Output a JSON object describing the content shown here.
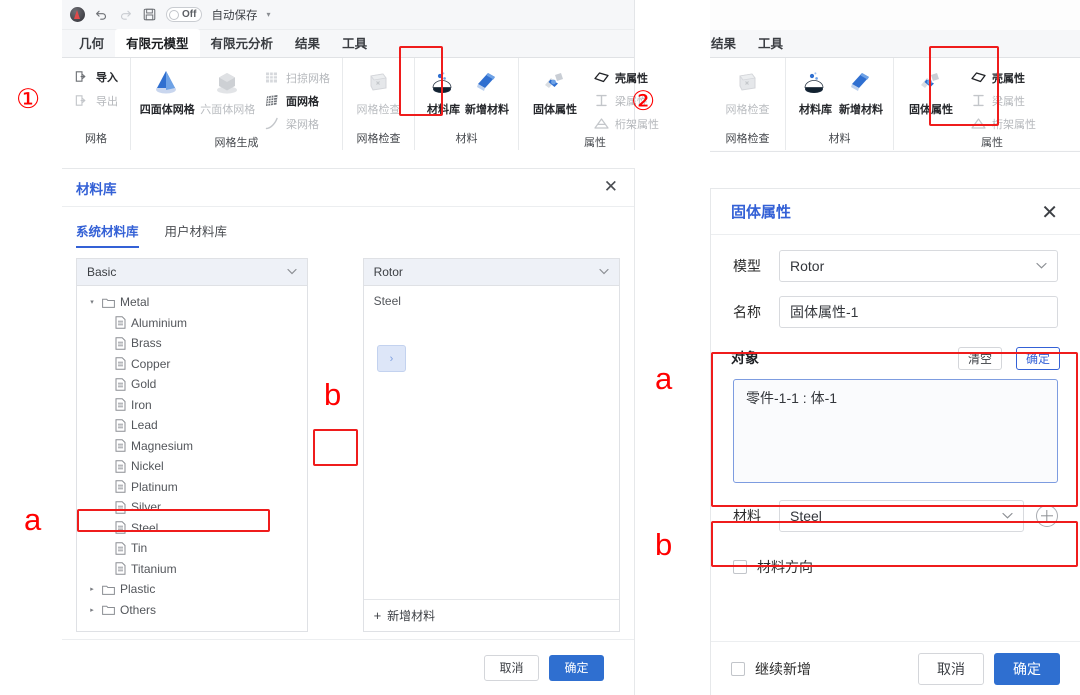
{
  "markers": {
    "step1": "①",
    "step2": "②",
    "lib_a": "a",
    "lib_b": "b",
    "panel_a": "a",
    "panel_b": "b"
  },
  "ribbon": {
    "quick_access": {
      "app_icon": "app-logo-icon",
      "undo_icon": "undo-icon",
      "redo_icon": "redo-icon",
      "save_icon": "save-icon",
      "toggle_label": "Off",
      "autosave_label": "自动保存",
      "caret": "▾"
    },
    "tabs": [
      {
        "label": "几何",
        "active": false
      },
      {
        "label": "有限元模型",
        "active": true
      },
      {
        "label": "有限元分析",
        "active": false
      },
      {
        "label": "结果",
        "active": false
      },
      {
        "label": "工具",
        "active": false
      }
    ],
    "groups": [
      {
        "title": "网格",
        "items": [
          {
            "label": "导入",
            "icon": "import-icon",
            "enabled": true
          },
          {
            "label": "导出",
            "icon": "export-icon",
            "enabled": false
          }
        ]
      },
      {
        "title": "网格生成",
        "items": [
          {
            "label": "四面体网格",
            "icon": "tetra-mesh-icon",
            "enabled": true
          },
          {
            "label": "六面体网格",
            "icon": "hexa-mesh-icon",
            "enabled": false
          },
          {
            "label": "扫掠网格",
            "icon": "sweep-mesh-icon",
            "enabled": false
          },
          {
            "label": "面网格",
            "icon": "face-mesh-icon",
            "enabled": true
          },
          {
            "label": "梁网格",
            "icon": "beam-mesh-icon",
            "enabled": false
          }
        ]
      },
      {
        "title": "网格检查",
        "items": [
          {
            "label": "网格检查",
            "icon": "mesh-check-icon",
            "enabled": false
          }
        ]
      },
      {
        "title": "材料",
        "items": [
          {
            "label": "材料库",
            "icon": "material-library-icon",
            "enabled": true,
            "highlighted": true
          },
          {
            "label": "新增材料",
            "icon": "add-material-icon",
            "enabled": true
          }
        ]
      },
      {
        "title": "属性",
        "items": [
          {
            "label": "固体属性",
            "icon": "solid-property-icon",
            "enabled": true
          },
          {
            "label": "壳属性",
            "icon": "shell-property-icon",
            "enabled": true
          },
          {
            "label": "梁属性",
            "icon": "beam-property-icon",
            "enabled": false
          },
          {
            "label": "桁架属性",
            "icon": "truss-property-icon",
            "enabled": false
          }
        ]
      }
    ]
  },
  "material_library": {
    "title": "材料库",
    "close_icon": "close-icon",
    "tabs": [
      {
        "label": "系统材料库",
        "active": true
      },
      {
        "label": "用户材料库",
        "active": false
      }
    ],
    "left_pane": {
      "header": "Basic",
      "chevron": "⌄",
      "tree": [
        {
          "label": "Metal",
          "type": "folder",
          "level": 1,
          "twisty": "▾"
        },
        {
          "label": "Aluminium",
          "type": "doc",
          "level": 2
        },
        {
          "label": "Brass",
          "type": "doc",
          "level": 2
        },
        {
          "label": "Copper",
          "type": "doc",
          "level": 2
        },
        {
          "label": "Gold",
          "type": "doc",
          "level": 2
        },
        {
          "label": "Iron",
          "type": "doc",
          "level": 2
        },
        {
          "label": "Lead",
          "type": "doc",
          "level": 2
        },
        {
          "label": "Magnesium",
          "type": "doc",
          "level": 2
        },
        {
          "label": "Nickel",
          "type": "doc",
          "level": 2
        },
        {
          "label": "Platinum",
          "type": "doc",
          "level": 2
        },
        {
          "label": "Silver",
          "type": "doc",
          "level": 2
        },
        {
          "label": "Steel",
          "type": "doc",
          "level": 2,
          "highlighted": true
        },
        {
          "label": "Tin",
          "type": "doc",
          "level": 2
        },
        {
          "label": "Titanium",
          "type": "doc",
          "level": 2
        },
        {
          "label": "Plastic",
          "type": "folder",
          "level": 1,
          "twisty": "▸"
        },
        {
          "label": "Others",
          "type": "folder",
          "level": 1,
          "twisty": "▸"
        }
      ]
    },
    "transfer_button": {
      "icon": "chevron-right-icon",
      "glyph": "›"
    },
    "right_pane": {
      "header": "Rotor",
      "chevron": "⌄",
      "items": [
        "Steel"
      ],
      "add_label": "新增材料",
      "add_plus": "+"
    },
    "footer": {
      "cancel": "取消",
      "confirm": "确定"
    }
  },
  "solid_property": {
    "title": "固体属性",
    "close_icon": "close-icon",
    "model_label": "模型",
    "model_value": "Rotor",
    "name_label": "名称",
    "name_value": "固体属性-1",
    "object_section": {
      "title": "对象",
      "clear_label": "清空",
      "confirm_label": "确定",
      "items": [
        "零件-1-1 : 体-1"
      ]
    },
    "material_label": "材料",
    "material_value": "Steel",
    "material_add_icon": "plus-circle-icon",
    "material_direction_label": "材料方向",
    "material_direction_checked": false,
    "continue_add_label": "继续新增",
    "continue_add_checked": false,
    "footer": {
      "cancel": "取消",
      "confirm": "确定"
    },
    "chevron": "⌄"
  },
  "colors": {
    "accent": "#3461d6",
    "primary_button": "#2f6fd0",
    "highlight_red": "#ef1c1c",
    "marker_red": "#ff0000"
  }
}
